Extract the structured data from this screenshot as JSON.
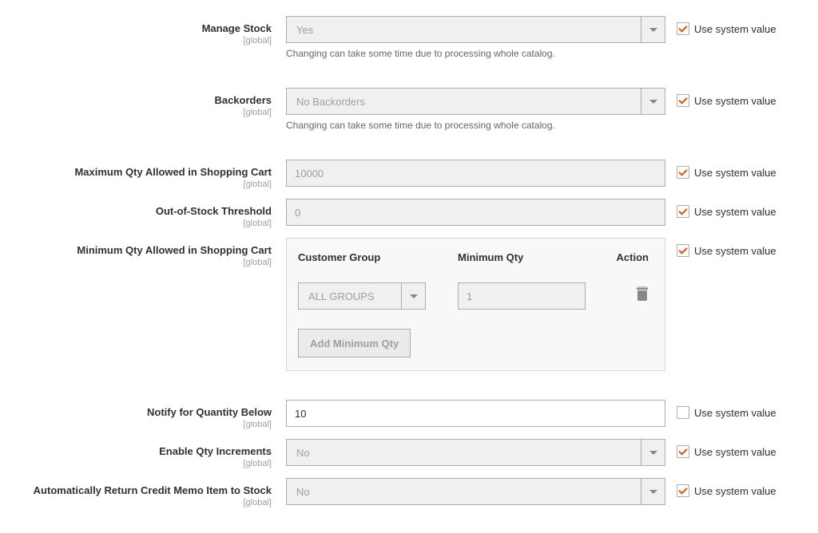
{
  "scope_label": "[global]",
  "use_system_label": "Use system value",
  "catalog_helper": "Changing can take some time due to processing whole catalog.",
  "fields": {
    "manage_stock": {
      "label": "Manage Stock",
      "value": "Yes",
      "use_system": true
    },
    "backorders": {
      "label": "Backorders",
      "value": "No Backorders",
      "use_system": true
    },
    "max_qty": {
      "label": "Maximum Qty Allowed in Shopping Cart",
      "value": "10000",
      "use_system": true
    },
    "oos_threshold": {
      "label": "Out-of-Stock Threshold",
      "value": "0",
      "use_system": true
    },
    "min_qty_group": {
      "label": "Minimum Qty Allowed in Shopping Cart",
      "use_system": true
    },
    "notify_below": {
      "label": "Notify for Quantity Below",
      "value": "10",
      "use_system": false
    },
    "enable_qty_inc": {
      "label": "Enable Qty Increments",
      "value": "No",
      "use_system": true
    },
    "auto_return": {
      "label": "Automatically Return Credit Memo Item to Stock",
      "value": "No",
      "use_system": true
    }
  },
  "min_qty_table": {
    "headers": {
      "cg": "Customer Group",
      "qty": "Minimum Qty",
      "action": "Action"
    },
    "row": {
      "group": "ALL GROUPS",
      "qty": "1"
    },
    "add_label": "Add Minimum Qty"
  }
}
